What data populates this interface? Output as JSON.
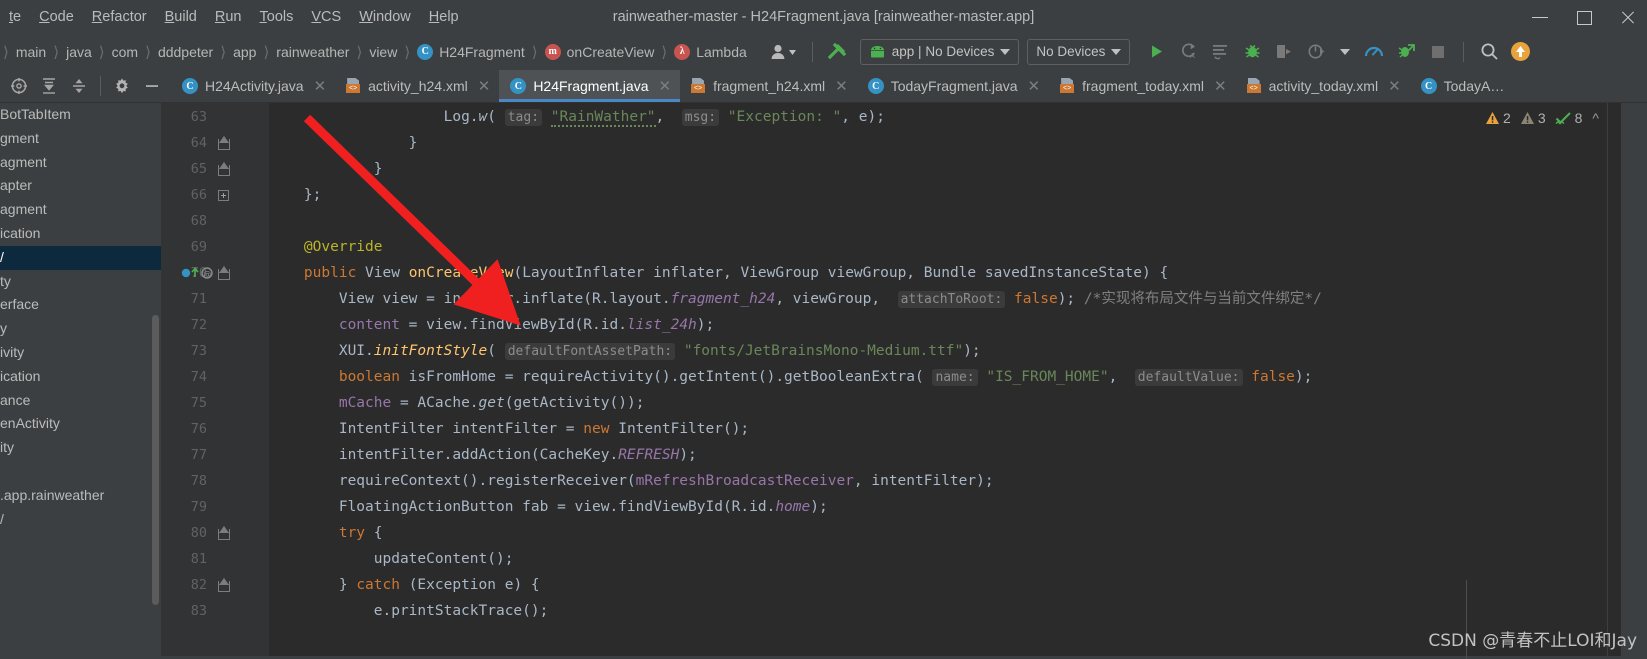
{
  "window": {
    "title": "rainweather-master - H24Fragment.java [rainweather-master.app]",
    "menu": [
      "te",
      "Code",
      "Refactor",
      "Build",
      "Run",
      "Tools",
      "VCS",
      "Window",
      "Help"
    ],
    "controls": [
      "minimize",
      "maximize",
      "close"
    ]
  },
  "breadcrumbs": [
    {
      "label": "main",
      "icon": ""
    },
    {
      "label": "java",
      "icon": ""
    },
    {
      "label": "com",
      "icon": ""
    },
    {
      "label": "dddpeter",
      "icon": ""
    },
    {
      "label": "app",
      "icon": ""
    },
    {
      "label": "rainweather",
      "icon": ""
    },
    {
      "label": "view",
      "icon": ""
    },
    {
      "label": "H24Fragment",
      "icon": "class-icon"
    },
    {
      "label": "onCreateView",
      "icon": "method-icon"
    },
    {
      "label": "Lambda",
      "icon": "lambda-icon"
    }
  ],
  "toolbar": {
    "avatar_label": "user-avatar",
    "build_label": "build-hammer",
    "run_config": "app | No Devices",
    "device_selector": "No Devices",
    "actions": [
      "run-icon",
      "apply-changes-icon",
      "apply-code-changes-icon",
      "debug-icon",
      "attach-debugger-icon",
      "profile-icon",
      "profiler-icon",
      "layout-inspector-icon",
      "stop-icon",
      "search-icon",
      "updates-icon"
    ]
  },
  "editor_tabs": {
    "tools": [
      "locate-icon",
      "collapse-all-icon",
      "expand-icon",
      "settings-icon",
      "hide-icon"
    ],
    "items": [
      {
        "label": "H24Activity.java",
        "icon": "java-class-icon",
        "active": false
      },
      {
        "label": "activity_h24.xml",
        "icon": "xml-layout-icon",
        "active": false
      },
      {
        "label": "H24Fragment.java",
        "icon": "java-class-icon",
        "active": true
      },
      {
        "label": "fragment_h24.xml",
        "icon": "xml-layout-icon",
        "active": false
      },
      {
        "label": "TodayFragment.java",
        "icon": "java-class-icon",
        "active": false
      },
      {
        "label": "fragment_today.xml",
        "icon": "xml-layout-icon",
        "active": false
      },
      {
        "label": "activity_today.xml",
        "icon": "xml-layout-icon",
        "active": false
      },
      {
        "label": "TodayA…",
        "icon": "java-class-icon",
        "active": false
      }
    ]
  },
  "project_panel": {
    "rows": [
      {
        "text": "BotTabItem",
        "selected": false
      },
      {
        "text": "gment",
        "selected": false
      },
      {
        "text": "agment",
        "selected": false
      },
      {
        "text": "apter",
        "selected": false
      },
      {
        "text": "agment",
        "selected": false
      },
      {
        "text": "ication",
        "selected": false
      },
      {
        "text": "/",
        "selected": true
      },
      {
        "text": "ty",
        "selected": false
      },
      {
        "text": "erface",
        "selected": false
      },
      {
        "text": "y",
        "selected": false
      },
      {
        "text": "ivity",
        "selected": false
      },
      {
        "text": "ication",
        "selected": false
      },
      {
        "text": "ance",
        "selected": false
      },
      {
        "text": "enActivity",
        "selected": false
      },
      {
        "text": "ity",
        "selected": false
      },
      {
        "text": "",
        "selected": false
      },
      {
        "text": ".app.rainweather",
        "selected": false
      },
      {
        "text": "/",
        "selected": false
      }
    ]
  },
  "inspection": {
    "warnings": "2",
    "weak_warnings": "3",
    "checks": "8",
    "collapse": "^"
  },
  "watermark": "CSDN @青春不止LOI和Jay",
  "code": {
    "first_line_number": 63,
    "lines": [
      {
        "num": "63",
        "indent": 0,
        "fold": "",
        "marker": "",
        "tokens": [
          {
            "t": "                    ",
            "c": "plain"
          },
          {
            "t": "Log.",
            "c": "plain"
          },
          {
            "t": "w",
            "c": "ital"
          },
          {
            "t": "( ",
            "c": "plain"
          },
          {
            "t": "tag:",
            "c": "hint"
          },
          {
            "t": " ",
            "c": "plain"
          },
          {
            "t": "\"RainWather\"",
            "c": "str-typo"
          },
          {
            "t": ",  ",
            "c": "plain"
          },
          {
            "t": "msg:",
            "c": "hint"
          },
          {
            "t": " ",
            "c": "plain"
          },
          {
            "t": "\"Exception: \"",
            "c": "str"
          },
          {
            "t": ", e);",
            "c": "plain"
          }
        ]
      },
      {
        "num": "64",
        "indent": 0,
        "fold": "arrow",
        "marker": "",
        "tokens": [
          {
            "t": "                }",
            "c": "plain"
          }
        ]
      },
      {
        "num": "65",
        "indent": 0,
        "fold": "arrow",
        "marker": "",
        "tokens": [
          {
            "t": "            }",
            "c": "plain"
          }
        ]
      },
      {
        "num": "66",
        "indent": 0,
        "fold": "plus",
        "marker": "",
        "tokens": [
          {
            "t": "    };",
            "c": "plain"
          }
        ]
      },
      {
        "num": "68",
        "indent": 0,
        "fold": "",
        "marker": "",
        "tokens": [
          {
            "t": "",
            "c": "plain"
          }
        ]
      },
      {
        "num": "69",
        "indent": 0,
        "fold": "",
        "marker": "",
        "tokens": [
          {
            "t": "    ",
            "c": "plain"
          },
          {
            "t": "@Override",
            "c": "anno"
          }
        ]
      },
      {
        "num": "70",
        "indent": 0,
        "fold": "arrow",
        "marker": "override",
        "tokens": [
          {
            "t": "    ",
            "c": "plain"
          },
          {
            "t": "public",
            "c": "kw"
          },
          {
            "t": " View ",
            "c": "plain"
          },
          {
            "t": "onCreateView",
            "c": "fn"
          },
          {
            "t": "(LayoutInflater inflater, ViewGroup viewGroup, Bundle savedInstanceState) {",
            "c": "plain"
          }
        ]
      },
      {
        "num": "71",
        "indent": 1,
        "fold": "",
        "marker": "",
        "tokens": [
          {
            "t": "        View view = inflater.inflate(R.layout.",
            "c": "plain"
          },
          {
            "t": "fragment_h24",
            "c": "fielditalic"
          },
          {
            "t": ", viewGroup,  ",
            "c": "plain"
          },
          {
            "t": "attachToRoot:",
            "c": "hint"
          },
          {
            "t": " ",
            "c": "plain"
          },
          {
            "t": "false",
            "c": "kw"
          },
          {
            "t": "); ",
            "c": "plain"
          },
          {
            "t": "/*实现将布局文件与当前文件绑定*/",
            "c": "cmt"
          }
        ]
      },
      {
        "num": "72",
        "indent": 1,
        "fold": "",
        "marker": "",
        "tokens": [
          {
            "t": "        ",
            "c": "plain"
          },
          {
            "t": "content",
            "c": "field"
          },
          {
            "t": " = view.findViewById(R.id.",
            "c": "plain"
          },
          {
            "t": "list_24h",
            "c": "fielditalic"
          },
          {
            "t": ");",
            "c": "plain"
          }
        ]
      },
      {
        "num": "73",
        "indent": 1,
        "fold": "",
        "marker": "",
        "tokens": [
          {
            "t": "        XUI.",
            "c": "plain"
          },
          {
            "t": "initFontStyle",
            "c": "fnital"
          },
          {
            "t": "( ",
            "c": "plain"
          },
          {
            "t": "defaultFontAssetPath:",
            "c": "hint"
          },
          {
            "t": " ",
            "c": "plain"
          },
          {
            "t": "\"fonts/JetBrainsMono-Medium.ttf\"",
            "c": "str"
          },
          {
            "t": ");",
            "c": "plain"
          }
        ]
      },
      {
        "num": "74",
        "indent": 1,
        "fold": "",
        "marker": "",
        "tokens": [
          {
            "t": "        ",
            "c": "plain"
          },
          {
            "t": "boolean",
            "c": "kw"
          },
          {
            "t": " isFromHome = requireActivity().getIntent().getBooleanExtra( ",
            "c": "plain"
          },
          {
            "t": "name:",
            "c": "hint"
          },
          {
            "t": " ",
            "c": "plain"
          },
          {
            "t": "\"IS_FROM_HOME\"",
            "c": "str"
          },
          {
            "t": ",  ",
            "c": "plain"
          },
          {
            "t": "defaultValue:",
            "c": "hint"
          },
          {
            "t": " ",
            "c": "plain"
          },
          {
            "t": "false",
            "c": "kw"
          },
          {
            "t": ");",
            "c": "plain"
          }
        ]
      },
      {
        "num": "75",
        "indent": 1,
        "fold": "",
        "marker": "",
        "tokens": [
          {
            "t": "        ",
            "c": "plain"
          },
          {
            "t": "mCache",
            "c": "field"
          },
          {
            "t": " = ACache.",
            "c": "plain"
          },
          {
            "t": "get",
            "c": "ital"
          },
          {
            "t": "(getActivity());",
            "c": "plain"
          }
        ]
      },
      {
        "num": "76",
        "indent": 1,
        "fold": "",
        "marker": "",
        "tokens": [
          {
            "t": "        IntentFilter intentFilter = ",
            "c": "plain"
          },
          {
            "t": "new",
            "c": "kw"
          },
          {
            "t": " IntentFilter();",
            "c": "plain"
          }
        ]
      },
      {
        "num": "77",
        "indent": 1,
        "fold": "",
        "marker": "",
        "tokens": [
          {
            "t": "        intentFilter.addAction(CacheKey.",
            "c": "plain"
          },
          {
            "t": "REFRESH",
            "c": "fielditalic"
          },
          {
            "t": ");",
            "c": "plain"
          }
        ]
      },
      {
        "num": "78",
        "indent": 1,
        "fold": "",
        "marker": "",
        "tokens": [
          {
            "t": "        requireContext().registerReceiver(",
            "c": "plain"
          },
          {
            "t": "mRefreshBroadcastReceiver",
            "c": "field"
          },
          {
            "t": ", intentFilter);",
            "c": "plain"
          }
        ]
      },
      {
        "num": "79",
        "indent": 1,
        "fold": "",
        "marker": "",
        "tokens": [
          {
            "t": "        FloatingActionButton fab = view.findViewById(R.id.",
            "c": "plain"
          },
          {
            "t": "home",
            "c": "fielditalic"
          },
          {
            "t": ");",
            "c": "plain"
          }
        ]
      },
      {
        "num": "80",
        "indent": 1,
        "fold": "arrow",
        "marker": "",
        "tokens": [
          {
            "t": "        ",
            "c": "plain"
          },
          {
            "t": "try",
            "c": "kw"
          },
          {
            "t": " {",
            "c": "plain"
          }
        ]
      },
      {
        "num": "81",
        "indent": 2,
        "fold": "",
        "marker": "",
        "tokens": [
          {
            "t": "            updateContent();",
            "c": "plain"
          }
        ]
      },
      {
        "num": "82",
        "indent": 1,
        "fold": "arrow",
        "marker": "",
        "tokens": [
          {
            "t": "        } ",
            "c": "plain"
          },
          {
            "t": "catch",
            "c": "kw"
          },
          {
            "t": " (Exception e) {",
            "c": "plain"
          }
        ]
      },
      {
        "num": "83",
        "indent": 2,
        "fold": "",
        "marker": "",
        "tokens": [
          {
            "t": "            e.printStackTrace();",
            "c": "plain"
          }
        ]
      }
    ]
  }
}
